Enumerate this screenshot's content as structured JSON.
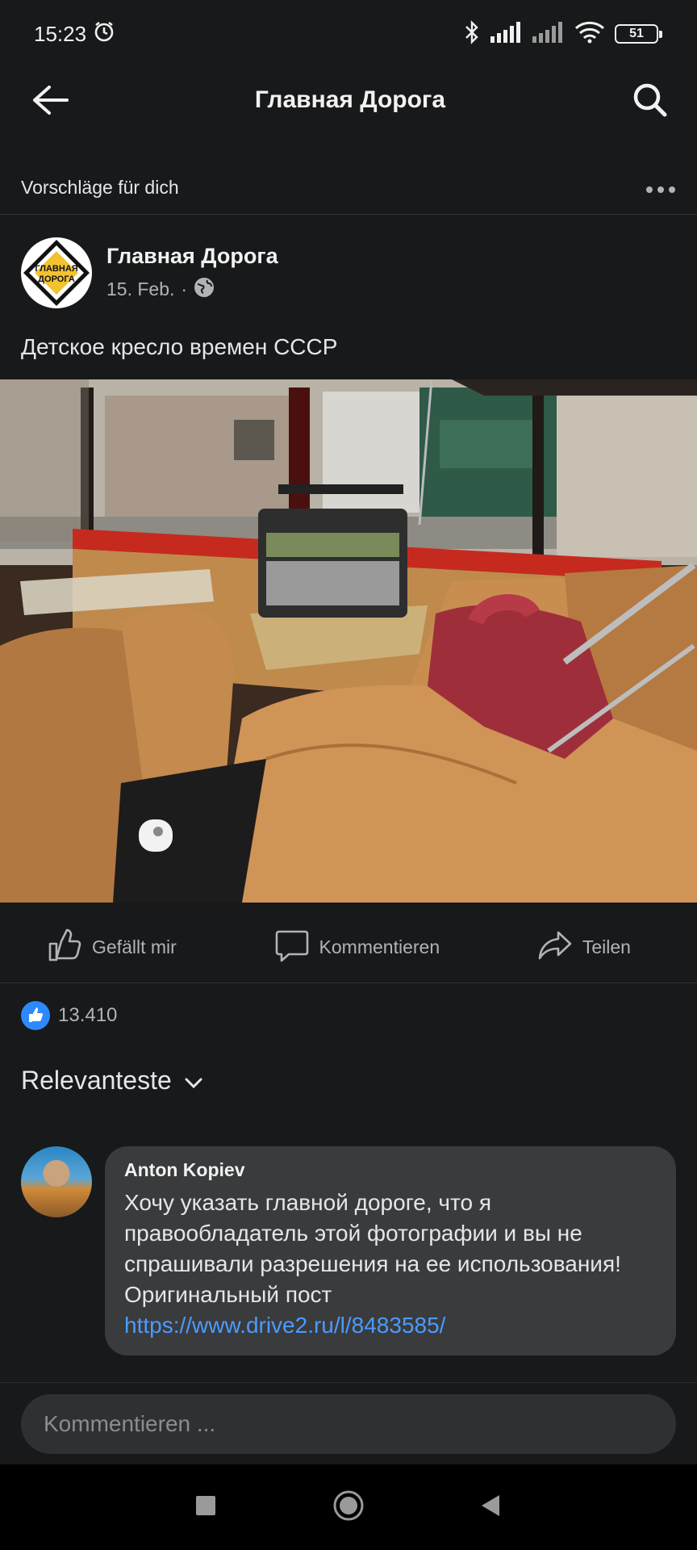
{
  "status_bar": {
    "time": "15:23",
    "battery": "51",
    "icons": [
      "alarm-icon",
      "bluetooth-icon",
      "signal-icon",
      "signal-icon",
      "wifi-icon",
      "battery-icon"
    ]
  },
  "app_bar": {
    "title": "Главная Дорога",
    "back_icon": "arrow-left-icon",
    "search_icon": "search-icon"
  },
  "suggestions": {
    "label": "Vorschläge für dich",
    "more_icon": "more-horizontal-icon"
  },
  "post": {
    "author": "Главная Дорога",
    "date": "15. Feb.",
    "separator": "·",
    "privacy_icon": "globe-icon",
    "logo_text": [
      "ГЛАВНАЯ",
      "ДОРОГА"
    ],
    "text": "Детское кресло времен СССР",
    "actions": {
      "like": "Gefällt mir",
      "comment": "Kommentieren",
      "share": "Teilen"
    },
    "reactions_count": "13.410"
  },
  "comments": {
    "sort_label": "Relevanteste",
    "items": [
      {
        "author": "Anton Kopiev",
        "text": "Хочу указать главной дороге, что я правообладатель этой фотографии и вы не спрашивали разрешения на ее использования!\nОригинальный пост",
        "link": "https://www.drive2.ru/l/8483585/"
      }
    ]
  },
  "composer": {
    "placeholder": "Kommentieren ..."
  },
  "colors": {
    "background": "#18191a",
    "bubble": "#3a3b3c",
    "link": "#4b9bff",
    "like_blue": "#2e89ff"
  }
}
